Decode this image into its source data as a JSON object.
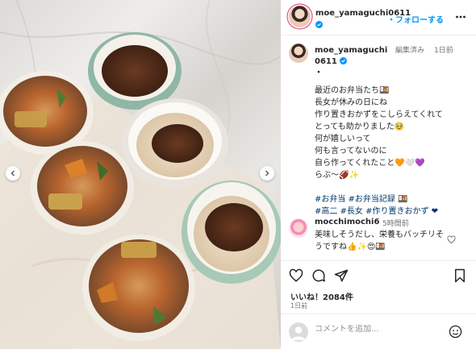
{
  "post": {
    "username": "moe_yamaguchi0611",
    "follow_label": "・フォローする",
    "more_icon": "more-horizontal-icon"
  },
  "caption": {
    "username": "moe_yamaguchi0611",
    "edited": "編集済み",
    "separator": "・",
    "time": "1日前",
    "lines": [
      "最近のお弁当たち🍱",
      "長女が休みの日にね",
      "作り置きおかずをこしらえてくれて",
      "とっても助かりました🥹",
      "何が嬉しいって",
      "何も言ってないのに",
      "自ら作ってくれたこと🧡🤍💜",
      "らぶ〜🏈✨"
    ],
    "hashtags": [
      "#お弁当 #お弁当記録 🍱",
      "#高二 #長女 #作り置きおかず ❤"
    ]
  },
  "comment": {
    "username": "mocchimochi6",
    "time": "5時間前",
    "text": "美味しそうだし、栄養もバッチリそうですね👍✨😍🍱"
  },
  "actions": {
    "likes": "いいね！2084件",
    "posted": "1日前"
  },
  "comment_box": {
    "placeholder": "コメントを追加..."
  },
  "colors": {
    "accent": "#0095f6",
    "verified": "#0095f6",
    "hashtag": "#00376b",
    "muted": "#737373"
  }
}
